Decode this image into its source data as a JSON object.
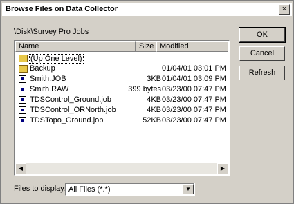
{
  "window": {
    "title": "Browse Files on Data Collector",
    "close_glyph": "×"
  },
  "path": "\\Disk\\Survey Pro Jobs",
  "columns": {
    "name": "Name",
    "size": "Size",
    "modified": "Modified"
  },
  "files": [
    {
      "name": "(Up One Level)",
      "size": "",
      "modified": "",
      "icon": "up-folder-icon"
    },
    {
      "name": "Backup",
      "size": "",
      "modified": "01/04/01  03:01 PM",
      "icon": "folder-icon"
    },
    {
      "name": "Smith.JOB",
      "size": "3KB",
      "modified": "01/04/01  03:09 PM",
      "icon": "file-icon"
    },
    {
      "name": "Smith.RAW",
      "size": "399 bytes",
      "modified": "03/23/00  07:47 PM",
      "icon": "file-icon"
    },
    {
      "name": "TDSControl_Ground.job",
      "size": "4KB",
      "modified": "03/23/00  07:47 PM",
      "icon": "file-icon"
    },
    {
      "name": "TDSControl_ORNorth.job",
      "size": "4KB",
      "modified": "03/23/00  07:47 PM",
      "icon": "file-icon"
    },
    {
      "name": "TDSTopo_Ground.job",
      "size": "52KB",
      "modified": "03/23/00  07:47 PM",
      "icon": "file-icon"
    }
  ],
  "buttons": {
    "ok": "OK",
    "cancel": "Cancel",
    "refresh": "Refresh"
  },
  "filter": {
    "label": "Files to display:",
    "value": "All Files (*.*)"
  },
  "scroll": {
    "left": "◀",
    "right": "▶",
    "down": "▼"
  }
}
